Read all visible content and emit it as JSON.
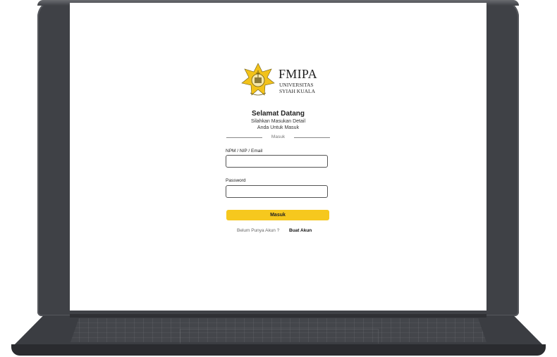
{
  "brand": {
    "name": "FMIPA",
    "subtitle_line1": "UNIVERSITAS",
    "subtitle_line2": "SYIAH KUALA",
    "accent_color": "#f6c81e",
    "logo_icon": "university-seal-icon"
  },
  "login": {
    "heading": "Selamat Datang",
    "description_line1": "Silahkan Masukan Detail",
    "description_line2": "Anda Untuk Masuk",
    "divider_label": "Masuk",
    "username_label": "NPM / NIP / Email",
    "username_value": "",
    "password_label": "Password",
    "password_value": "",
    "submit_label": "Masuk",
    "signup_prompt": "Belum Punya Akun ?",
    "signup_link": "Buat Akun"
  },
  "device": {
    "frame": "laptop",
    "body_color": "#3f4146"
  }
}
